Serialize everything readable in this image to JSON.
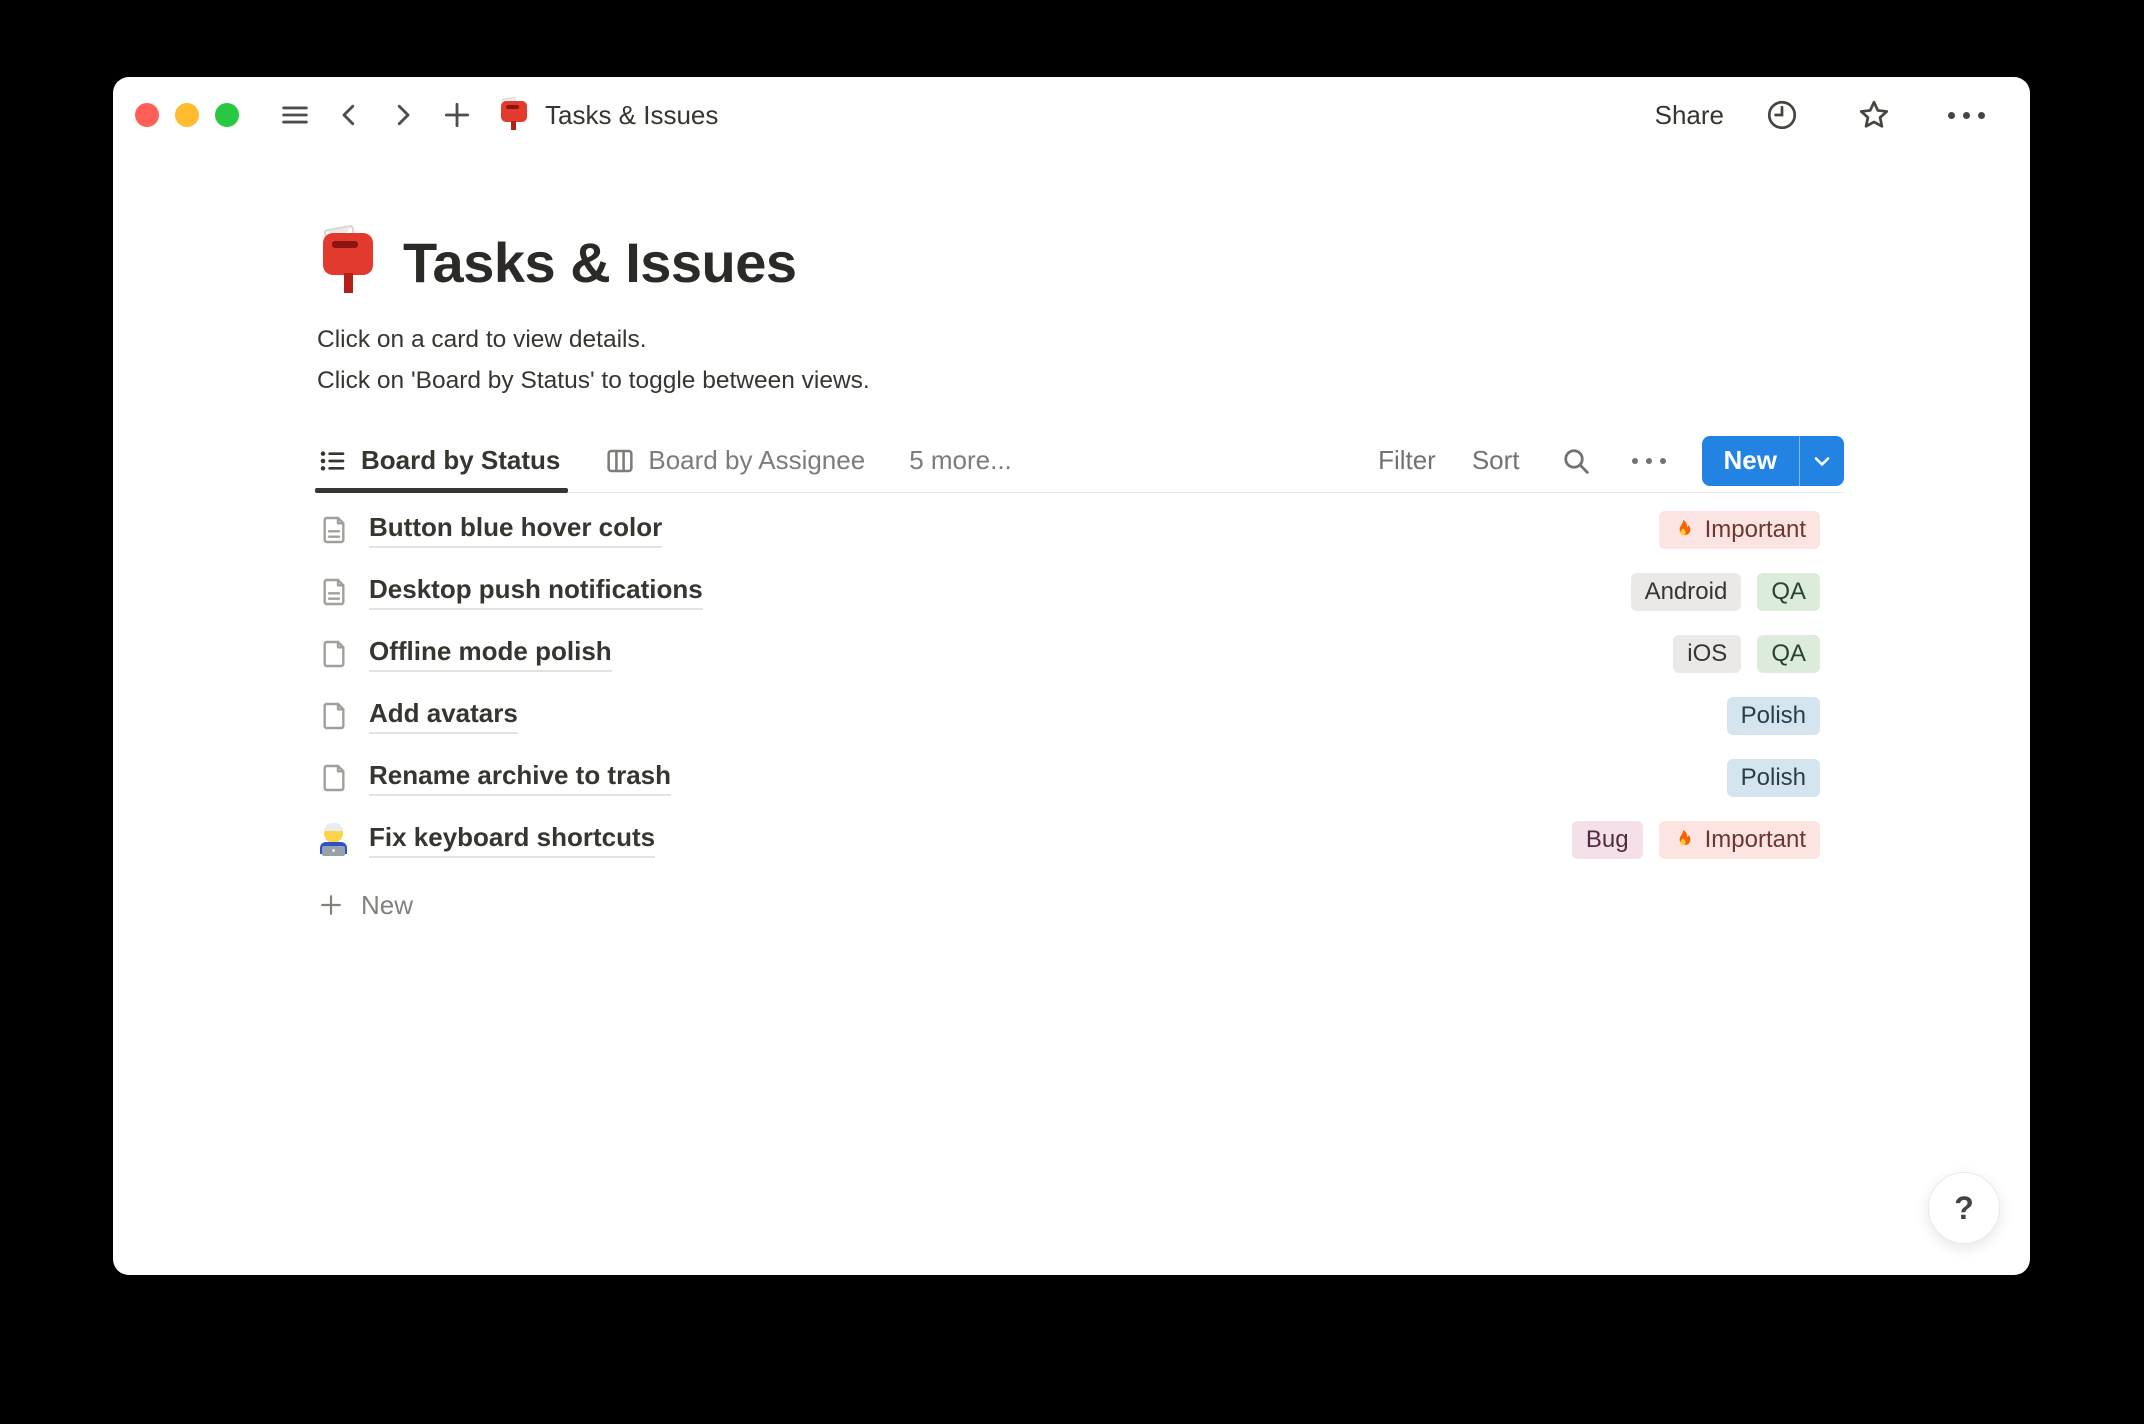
{
  "titlebar": {
    "page_title": "Tasks & Issues",
    "share_label": "Share"
  },
  "page": {
    "icon": "mailbox-emoji",
    "title": "Tasks & Issues",
    "description_line1": "Click on a card to view details.",
    "description_line2": "Click on 'Board by Status' to toggle between views."
  },
  "toolbar": {
    "tabs": [
      {
        "label": "Board by Status",
        "icon": "list-view-icon",
        "active": true
      },
      {
        "label": "Board by Assignee",
        "icon": "board-view-icon",
        "active": false
      },
      {
        "label": "5 more...",
        "icon": "none",
        "active": false
      }
    ],
    "filter_label": "Filter",
    "sort_label": "Sort",
    "search_icon": "search-icon",
    "more_icon": "ellipsis-icon",
    "new_button": {
      "label": "New",
      "caret_icon": "chevron-down-icon"
    }
  },
  "rows": [
    {
      "icon": "page-text-icon",
      "title": "Button blue hover color",
      "tags": [
        {
          "label": "Important",
          "color": "red",
          "icon": "fire-emoji"
        }
      ]
    },
    {
      "icon": "page-text-icon",
      "title": "Desktop push notifications",
      "tags": [
        {
          "label": "Android",
          "color": "gray"
        },
        {
          "label": "QA",
          "color": "green"
        }
      ]
    },
    {
      "icon": "page-blank-icon",
      "title": "Offline mode polish",
      "tags": [
        {
          "label": "iOS",
          "color": "gray"
        },
        {
          "label": "QA",
          "color": "green"
        }
      ]
    },
    {
      "icon": "page-blank-icon",
      "title": "Add avatars",
      "tags": [
        {
          "label": "Polish",
          "color": "blue"
        }
      ]
    },
    {
      "icon": "page-blank-icon",
      "title": "Rename archive to trash",
      "tags": [
        {
          "label": "Polish",
          "color": "blue"
        }
      ]
    },
    {
      "icon": "technologist-emoji",
      "title": "Fix keyboard shortcuts",
      "tags": [
        {
          "label": "Bug",
          "color": "pink"
        },
        {
          "label": "Important",
          "color": "red",
          "icon": "fire-emoji"
        }
      ]
    }
  ],
  "new_row_label": "New",
  "help_button_label": "?",
  "colors": {
    "accent_blue": "#2383E2",
    "traffic_red": "#FF5F57",
    "traffic_yellow": "#FEBC2E",
    "traffic_green": "#28C840",
    "tag_red_bg": "#FBE4E1",
    "tag_red_text": "#6E3630",
    "tag_gray_bg": "#EAE9E7",
    "tag_gray_text": "#36352F",
    "tag_green_bg": "#DCEBDC",
    "tag_green_text": "#28452C",
    "tag_blue_bg": "#D5E5EF",
    "tag_blue_text": "#2C3D49",
    "tag_pink_bg": "#F3E0E9",
    "tag_pink_text": "#542A41"
  }
}
